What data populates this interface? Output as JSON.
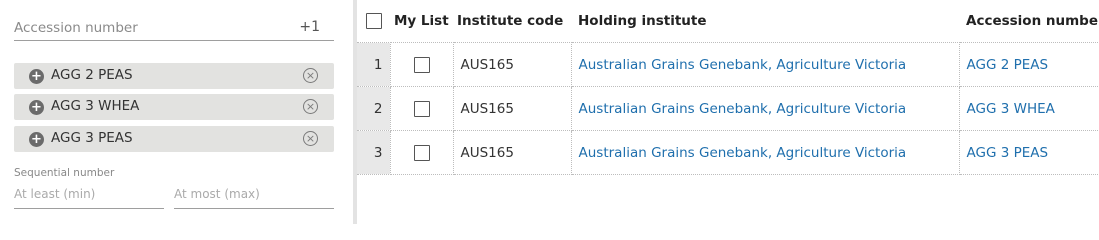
{
  "filters": {
    "accession_placeholder": "Accession number",
    "accession_extra_count": "+1",
    "chips": [
      {
        "label": "AGG 2 PEAS"
      },
      {
        "label": "AGG 3 WHEA"
      },
      {
        "label": "AGG 3 PEAS"
      }
    ],
    "sequential_label": "Sequential number",
    "min_placeholder": "At least (min)",
    "max_placeholder": "At most (max)"
  },
  "table": {
    "headers": {
      "my_list": "My List",
      "institute_code": "Institute code",
      "holding_institute": "Holding institute",
      "accession_number": "Accession number"
    },
    "rows": [
      {
        "num": "1",
        "institute_code": "AUS165",
        "holding_institute": "Australian Grains Genebank, Agriculture Victoria",
        "accession_number": "AGG 2 PEAS"
      },
      {
        "num": "2",
        "institute_code": "AUS165",
        "holding_institute": "Australian Grains Genebank, Agriculture Victoria",
        "accession_number": "AGG 3 WHEA"
      },
      {
        "num": "3",
        "institute_code": "AUS165",
        "holding_institute": "Australian Grains Genebank, Agriculture Victoria",
        "accession_number": "AGG 3 PEAS"
      }
    ]
  },
  "colors": {
    "link": "#1f6fad",
    "chip_bg": "#e2e2e0",
    "row_number_bg": "#e8e8e8"
  }
}
